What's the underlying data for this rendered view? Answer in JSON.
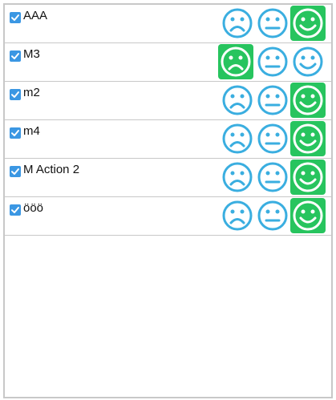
{
  "colors": {
    "icon_blue": "#3aaee0",
    "selected_green": "#27c45e",
    "checkbox_blue": "#3b97e3",
    "border": "#c8c8c8"
  },
  "rows": [
    {
      "label": "AAA",
      "checked": true,
      "selected": "happy"
    },
    {
      "label": "M3",
      "checked": true,
      "selected": "sad"
    },
    {
      "label": "m2",
      "checked": true,
      "selected": "happy"
    },
    {
      "label": "m4",
      "checked": true,
      "selected": "happy"
    },
    {
      "label": "M Action 2",
      "checked": true,
      "selected": "happy"
    },
    {
      "label": "ööö",
      "checked": true,
      "selected": "happy"
    }
  ]
}
